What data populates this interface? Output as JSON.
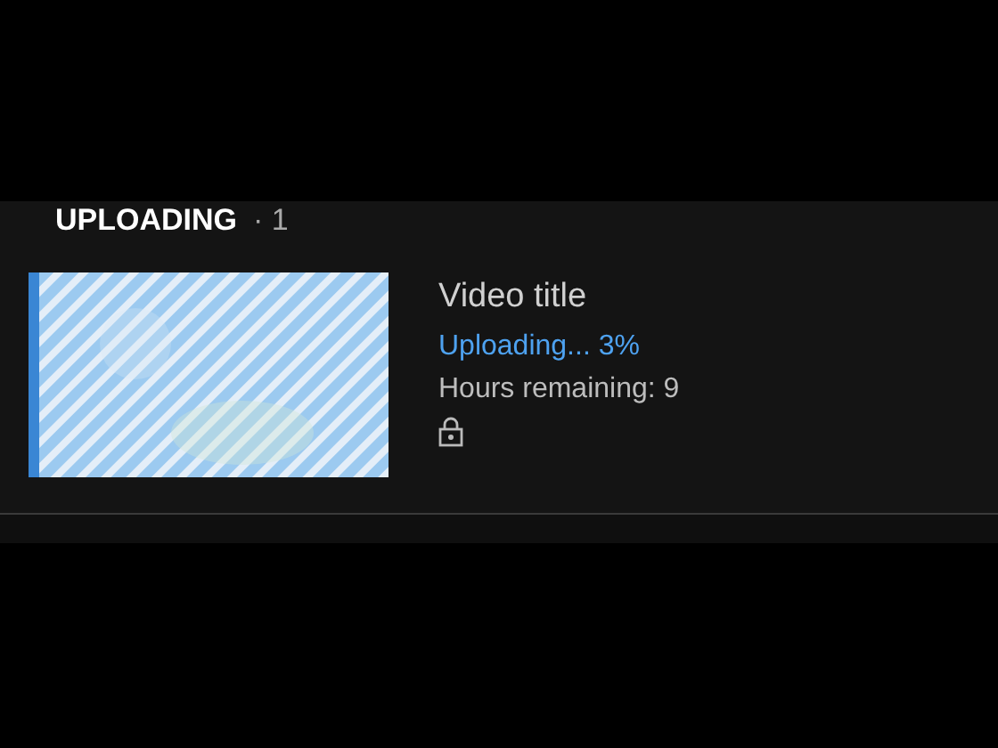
{
  "section": {
    "title": "UPLOADING",
    "count": "· 1"
  },
  "uploads": [
    {
      "progress": {
        "level": 0.03
      },
      "title": "Video title",
      "status": "Uploading... 3%",
      "remaining": "Hours remaining: 9",
      "private": true
    }
  ]
}
